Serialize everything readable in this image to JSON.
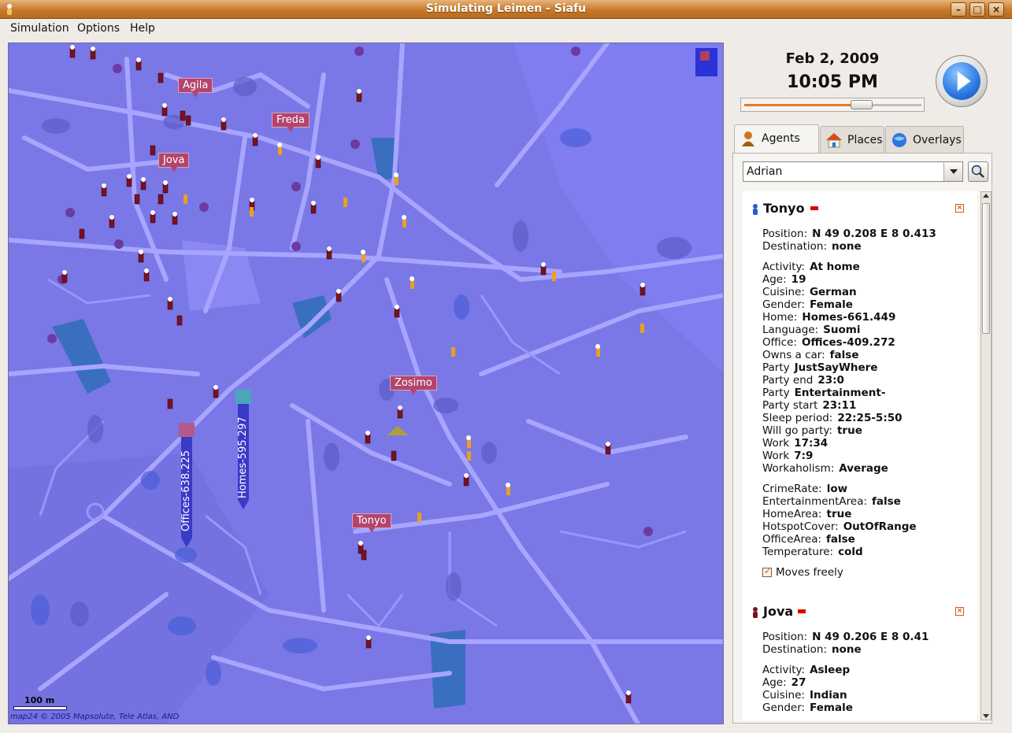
{
  "window": {
    "title": "Simulating Leimen - Siafu"
  },
  "menu": [
    {
      "label": "Simulation"
    },
    {
      "label": "Options"
    },
    {
      "label": "Help"
    }
  ],
  "map": {
    "agent_labels": [
      "Agila",
      "Freda",
      "Jova",
      "Zosimo",
      "Tonyo"
    ],
    "place_labels": [
      "Offices-638.225",
      "Homes-595.297"
    ],
    "scale_text": "100 m",
    "copyright": "map24 © 2005 Mapsolute, Tele Atlas, AND",
    "logo": "mapTP"
  },
  "clock": {
    "date": "Feb 2, 2009",
    "time": "10:05 PM",
    "progress_percent": 66
  },
  "tabs": [
    {
      "label": "Agents",
      "icon": "agents-icon",
      "active": true
    },
    {
      "label": "Places",
      "icon": "house-icon"
    },
    {
      "label": "Overlays",
      "icon": "globe-icon"
    }
  ],
  "search": {
    "value": "Adrian"
  },
  "agents": [
    {
      "name": "Tonyo",
      "rows": [
        [
          "Position:",
          "N 49 0.208 E 8 0.413"
        ],
        [
          "Destination:",
          "none"
        ],
        [
          "Activity:",
          "At home"
        ],
        [
          "Age:",
          "19"
        ],
        [
          "Cuisine:",
          "German"
        ],
        [
          "Gender:",
          "Female"
        ],
        [
          "Home:",
          "Homes-661.449"
        ],
        [
          "Language:",
          "Suomi"
        ],
        [
          "Office:",
          "Offices-409.272"
        ],
        [
          "Owns a car:",
          "false"
        ],
        [
          "Party",
          "JustSayWhere"
        ],
        [
          "Party end",
          "23:0"
        ],
        [
          "Party",
          "Entertainment-"
        ],
        [
          "Party start",
          "23:11"
        ],
        [
          "Sleep period:",
          "22:25-5:50"
        ],
        [
          "Will go party:",
          "true"
        ],
        [
          "Work",
          "17:34"
        ],
        [
          "Work",
          "7:9"
        ],
        [
          "Workaholism:",
          "Average"
        ],
        [
          "CrimeRate:",
          "low"
        ],
        [
          "EntertainmentArea:",
          "false"
        ],
        [
          "HomeArea:",
          "true"
        ],
        [
          "HotspotCover:",
          "OutOfRange"
        ],
        [
          "OfficeArea:",
          "false"
        ],
        [
          "Temperature:",
          "cold"
        ]
      ],
      "checkbox": "Moves freely"
    },
    {
      "name": "Jova",
      "rows": [
        [
          "Position:",
          "N 49 0.206 E 8 0.41"
        ],
        [
          "Destination:",
          "none"
        ],
        [
          "Activity:",
          "Asleep"
        ],
        [
          "Age:",
          "27"
        ],
        [
          "Cuisine:",
          "Indian"
        ],
        [
          "Gender:",
          "Female"
        ]
      ]
    }
  ]
}
